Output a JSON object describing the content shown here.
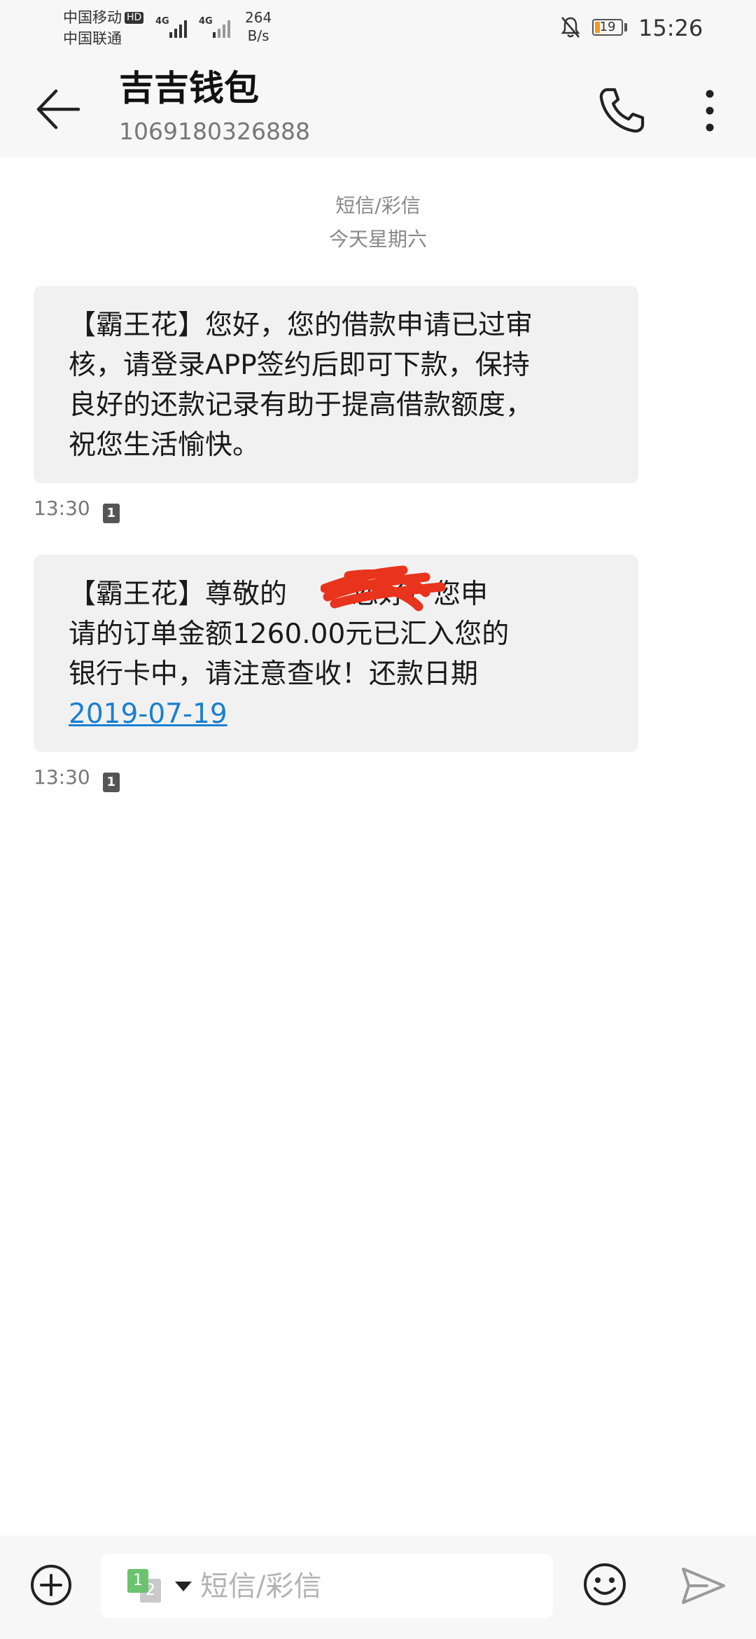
{
  "status_bar": {
    "carrier_1": "中国移动",
    "carrier_1_badge": "HD",
    "carrier_2": "中国联通",
    "network_1": "4G",
    "network_2": "4G",
    "speed_value": "264",
    "speed_unit": "B/s",
    "battery_level": "19",
    "battery_fraction": 0.19,
    "battery_color": "#f39a1e",
    "time": "15:26",
    "icons": [
      "signal-icon",
      "notifications-off-icon",
      "battery-icon"
    ]
  },
  "header": {
    "contact_name": "吉吉钱包",
    "contact_number": "1069180326888",
    "icons": [
      "back-arrow-icon",
      "phone-icon",
      "more-vert-icon"
    ]
  },
  "thread": {
    "type_label": "短信/彩信",
    "day_label": "今天星期六",
    "messages": [
      {
        "lines": [
          "【霸王花】您好，您的借款申请已过审",
          "核，请登录APP签约后即可下款，保持",
          "良好的还款记录有助于提高借款额度，",
          "祝您生活愉快。"
        ],
        "time": "13:30",
        "sim": "1"
      },
      {
        "lines": [
          "【霸王花】尊敬的",
          "请的订单金额1260.00元已汇入您的",
          "银行卡中，请注意查收！还款日期"
        ],
        "line_1_tail": "您好！您申",
        "date_link": "2019-07-19",
        "time": "13:30",
        "sim": "1"
      }
    ],
    "accent_color": "#1a7fd0",
    "redaction_color": "#e8341c"
  },
  "composer": {
    "sim_1": "1",
    "sim_2": "2",
    "placeholder": "短信/彩信",
    "icons": [
      "add-circle-icon",
      "dropdown-arrow-icon",
      "emoji-icon",
      "send-icon"
    ]
  }
}
